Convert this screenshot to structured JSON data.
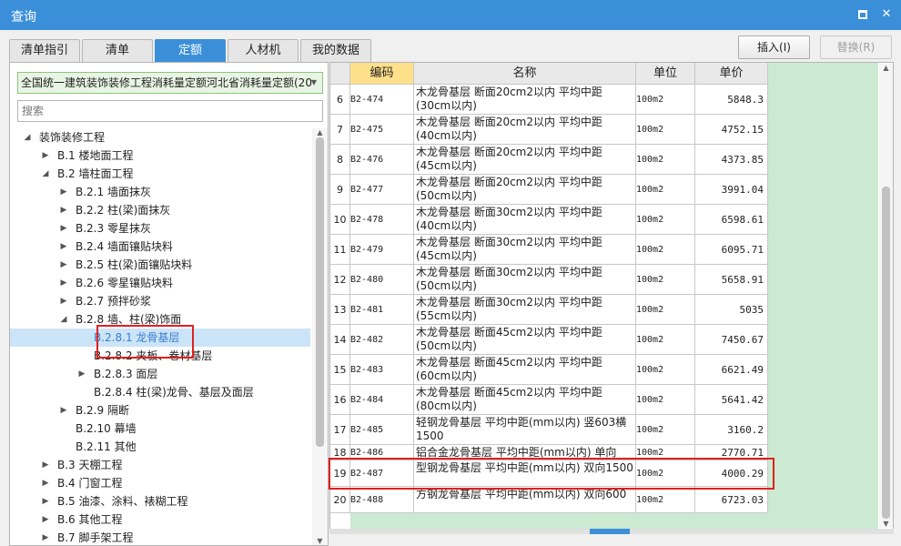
{
  "window": {
    "title": "查询"
  },
  "tabs": [
    {
      "label": "清单指引",
      "active": false
    },
    {
      "label": "清单",
      "active": false
    },
    {
      "label": "定额",
      "active": true
    },
    {
      "label": "人材机",
      "active": false
    },
    {
      "label": "我的数据",
      "active": false
    }
  ],
  "buttons": {
    "insert": "插入(I)",
    "replace": "替换(R)"
  },
  "left": {
    "library": "全国统一建筑装饰装修工程消耗量定额河北省消耗量定额(20",
    "search_placeholder": "搜索",
    "tree": [
      {
        "label": "装饰装修工程",
        "level": 0,
        "toggle": "expanded"
      },
      {
        "label": "B.1 楼地面工程",
        "level": 1,
        "toggle": "collapsed"
      },
      {
        "label": "B.2 墙柱面工程",
        "level": 1,
        "toggle": "expanded"
      },
      {
        "label": "B.2.1 墙面抹灰",
        "level": 2,
        "toggle": "collapsed"
      },
      {
        "label": "B.2.2 柱(梁)面抹灰",
        "level": 2,
        "toggle": "collapsed"
      },
      {
        "label": "B.2.3 零星抹灰",
        "level": 2,
        "toggle": "collapsed"
      },
      {
        "label": "B.2.4 墙面镶贴块料",
        "level": 2,
        "toggle": "collapsed"
      },
      {
        "label": "B.2.5 柱(梁)面镶贴块料",
        "level": 2,
        "toggle": "collapsed"
      },
      {
        "label": "B.2.6 零星镶贴块料",
        "level": 2,
        "toggle": "collapsed"
      },
      {
        "label": "B.2.7 预拌砂浆",
        "level": 2,
        "toggle": "collapsed"
      },
      {
        "label": "B.2.8 墙、柱(梁)饰面",
        "level": 2,
        "toggle": "expanded"
      },
      {
        "label": "B.2.8.1 龙骨基层",
        "level": 3,
        "toggle": "none",
        "selected": true
      },
      {
        "label": "B.2.8.2 夹板、卷材基层",
        "level": 3,
        "toggle": "none"
      },
      {
        "label": "B.2.8.3 面层",
        "level": 3,
        "toggle": "collapsed"
      },
      {
        "label": "B.2.8.4 柱(梁)龙骨、基层及面层",
        "level": 3,
        "toggle": "none"
      },
      {
        "label": "B.2.9 隔断",
        "level": 2,
        "toggle": "collapsed"
      },
      {
        "label": "B.2.10 幕墙",
        "level": 2,
        "toggle": "none"
      },
      {
        "label": "B.2.11 其他",
        "level": 2,
        "toggle": "none"
      },
      {
        "label": "B.3 天棚工程",
        "level": 1,
        "toggle": "collapsed"
      },
      {
        "label": "B.4 门窗工程",
        "level": 1,
        "toggle": "collapsed"
      },
      {
        "label": "B.5 油漆、涂料、裱糊工程",
        "level": 1,
        "toggle": "collapsed"
      },
      {
        "label": "B.6 其他工程",
        "level": 1,
        "toggle": "collapsed"
      },
      {
        "label": "B.7 脚手架工程",
        "level": 1,
        "toggle": "collapsed"
      }
    ]
  },
  "grid": {
    "headers": {
      "code": "编码",
      "name": "名称",
      "unit": "单位",
      "price": "单价"
    },
    "rows": [
      {
        "num": "6",
        "code": "B2-474",
        "name": "木龙骨基层 断面20cm2以内 平均中距(30cm以内)",
        "unit": "100m2",
        "price": "5848.3"
      },
      {
        "num": "7",
        "code": "B2-475",
        "name": "木龙骨基层 断面20cm2以内 平均中距(40cm以内)",
        "unit": "100m2",
        "price": "4752.15"
      },
      {
        "num": "8",
        "code": "B2-476",
        "name": "木龙骨基层 断面20cm2以内 平均中距(45cm以内)",
        "unit": "100m2",
        "price": "4373.85"
      },
      {
        "num": "9",
        "code": "B2-477",
        "name": "木龙骨基层 断面20cm2以内 平均中距(50cm以内)",
        "unit": "100m2",
        "price": "3991.04"
      },
      {
        "num": "10",
        "code": "B2-478",
        "name": "木龙骨基层 断面30cm2以内 平均中距(40cm以内)",
        "unit": "100m2",
        "price": "6598.61"
      },
      {
        "num": "11",
        "code": "B2-479",
        "name": "木龙骨基层 断面30cm2以内 平均中距(45cm以内)",
        "unit": "100m2",
        "price": "6095.71"
      },
      {
        "num": "12",
        "code": "B2-480",
        "name": "木龙骨基层 断面30cm2以内 平均中距(50cm以内)",
        "unit": "100m2",
        "price": "5658.91"
      },
      {
        "num": "13",
        "code": "B2-481",
        "name": "木龙骨基层 断面30cm2以内 平均中距(55cm以内)",
        "unit": "100m2",
        "price": "5035"
      },
      {
        "num": "14",
        "code": "B2-482",
        "name": "木龙骨基层 断面45cm2以内 平均中距(50cm以内)",
        "unit": "100m2",
        "price": "7450.67"
      },
      {
        "num": "15",
        "code": "B2-483",
        "name": "木龙骨基层 断面45cm2以内 平均中距(60cm以内)",
        "unit": "100m2",
        "price": "6621.49"
      },
      {
        "num": "16",
        "code": "B2-484",
        "name": "木龙骨基层 断面45cm2以内 平均中距(80cm以内)",
        "unit": "100m2",
        "price": "5641.42"
      },
      {
        "num": "17",
        "code": "B2-485",
        "name": "轻钢龙骨基层 平均中距(mm以内) 竖603横1500",
        "unit": "100m2",
        "price": "3160.2"
      },
      {
        "num": "18",
        "code": "B2-486",
        "name": "铝合金龙骨基层 平均中距(mm以内) 单向500",
        "unit": "100m2",
        "price": "2770.71"
      },
      {
        "num": "19",
        "code": "B2-487",
        "name": "型钢龙骨基层 平均中距(mm以内) 双向1500",
        "unit": "100m2",
        "price": "4000.29"
      },
      {
        "num": "20",
        "code": "B2-488",
        "name": "方钢龙骨基层 平均中距(mm以内) 双向600",
        "unit": "100m2",
        "price": "6723.03"
      }
    ]
  },
  "icons": {
    "maximize": "maximize-icon",
    "close": "close-icon"
  }
}
